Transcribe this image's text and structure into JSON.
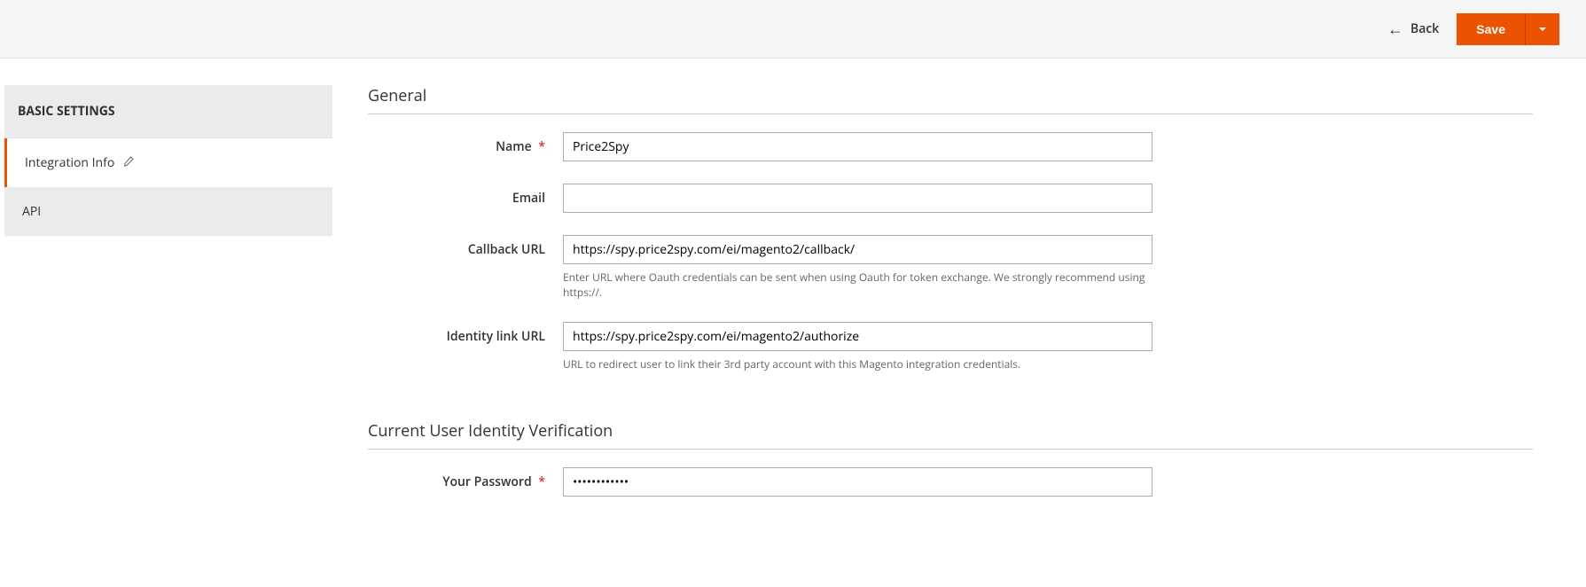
{
  "header": {
    "back_label": "Back",
    "save_label": "Save"
  },
  "sidebar": {
    "title": "BASIC SETTINGS",
    "items": [
      {
        "label": "Integration Info",
        "active": true,
        "has_edit": true
      },
      {
        "label": "API",
        "active": false,
        "has_edit": false
      }
    ]
  },
  "sections": {
    "general": {
      "title": "General",
      "fields": {
        "name": {
          "label": "Name",
          "value": "Price2Spy",
          "required": true
        },
        "email": {
          "label": "Email",
          "value": "",
          "required": false
        },
        "callback_url": {
          "label": "Callback URL",
          "value": "https://spy.price2spy.com/ei/magento2/callback/",
          "hint": "Enter URL where Oauth credentials can be sent when using Oauth for token exchange. We strongly recommend using https://.",
          "required": false
        },
        "identity_link_url": {
          "label": "Identity link URL",
          "value": "https://spy.price2spy.com/ei/magento2/authorize",
          "hint": "URL to redirect user to link their 3rd party account with this Magento integration credentials.",
          "required": false
        }
      }
    },
    "verification": {
      "title": "Current User Identity Verification",
      "fields": {
        "password": {
          "label": "Your Password",
          "value": "••••••••••••",
          "required": true
        }
      }
    }
  }
}
